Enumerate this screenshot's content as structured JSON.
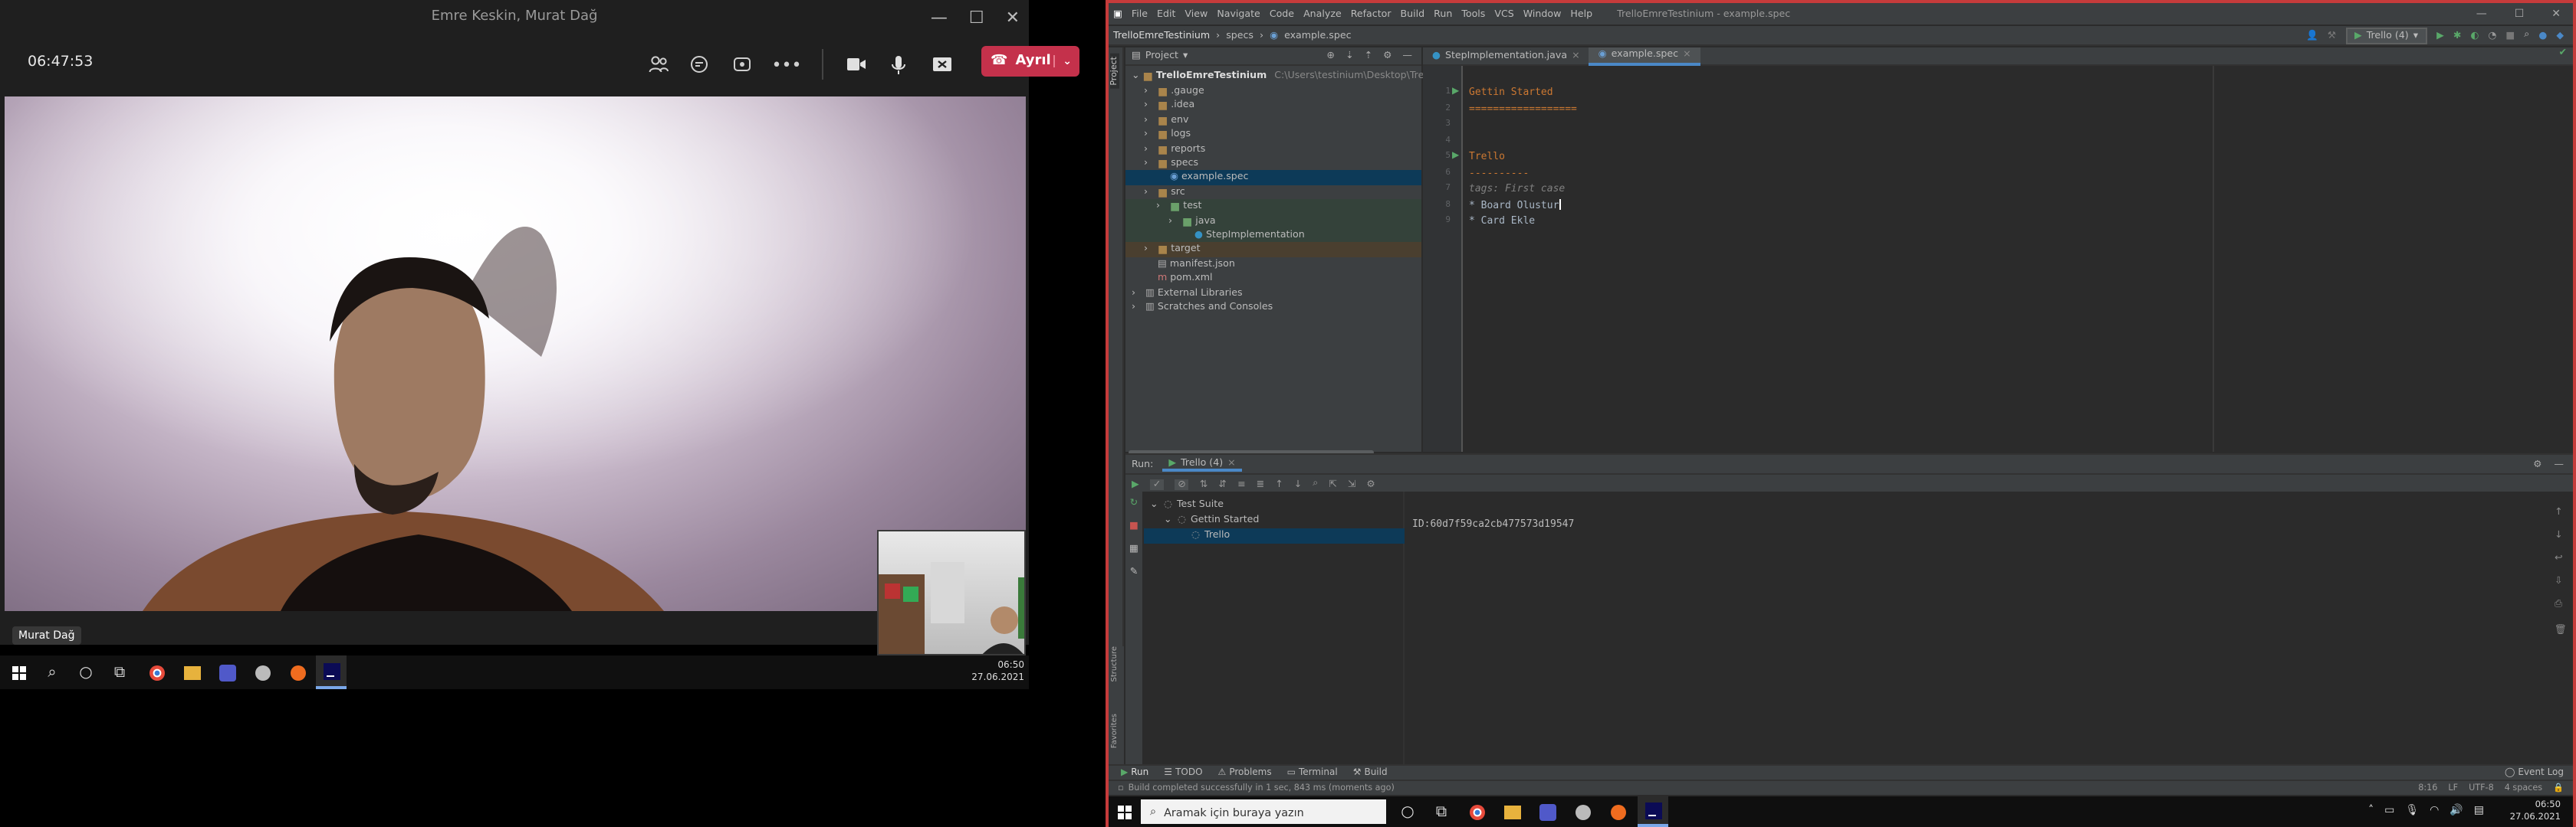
{
  "teams": {
    "title": "Emre Keskin, Murat Dağ",
    "timer": "06:47:53",
    "leave_label": "Ayrıl",
    "participant_name": "Murat Dağ"
  },
  "taskbar1": {
    "time": "06:50",
    "date": "27.06.2021"
  },
  "ide": {
    "menu": [
      "File",
      "Edit",
      "View",
      "Navigate",
      "Code",
      "Analyze",
      "Refactor",
      "Build",
      "Run",
      "Tools",
      "VCS",
      "Window",
      "Help"
    ],
    "window_title": "TrelloEmreTestinium - example.spec",
    "breadcrumb": [
      "TrelloEmreTestinium",
      "specs",
      "example.spec"
    ],
    "run_config": "Trello (4)",
    "project_label": "Project",
    "project_root": "TrelloEmreTestinium",
    "project_path": "C:\\Users\\testinium\\Desktop\\TrelloEmreTe",
    "tree": [
      {
        "label": ".gauge",
        "depth": 1
      },
      {
        "label": ".idea",
        "depth": 1
      },
      {
        "label": "env",
        "depth": 1
      },
      {
        "label": "logs",
        "depth": 1
      },
      {
        "label": "reports",
        "depth": 1
      },
      {
        "label": "specs",
        "depth": 1
      },
      {
        "label": "example.spec",
        "depth": 2
      },
      {
        "label": "src",
        "depth": 1
      },
      {
        "label": "test",
        "depth": 2
      },
      {
        "label": "java",
        "depth": 3
      },
      {
        "label": "StepImplementation",
        "depth": 4
      },
      {
        "label": "target",
        "depth": 1
      },
      {
        "label": "manifest.json",
        "depth": 1
      },
      {
        "label": "pom.xml",
        "depth": 1
      },
      {
        "label": "External Libraries",
        "depth": 0
      },
      {
        "label": "Scratches and Consoles",
        "depth": 0
      }
    ],
    "tabs": [
      "StepImplementation.java",
      "example.spec"
    ],
    "code_lines": [
      {
        "n": "1",
        "text": "Gettin Started",
        "color": "#cc7832"
      },
      {
        "n": "2",
        "text": "==================",
        "color": "#cc7832"
      },
      {
        "n": "3",
        "text": "",
        "color": "#a9b7c6"
      },
      {
        "n": "4",
        "text": "",
        "color": "#a9b7c6"
      },
      {
        "n": "5",
        "text": "Trello",
        "color": "#cc7832"
      },
      {
        "n": "6",
        "text": "----------",
        "color": "#cc7832"
      },
      {
        "n": "7",
        "text": "tags: First case",
        "color": "#808080"
      },
      {
        "n": "8",
        "text": "* Board Olustur",
        "color": "#a9b7c6"
      },
      {
        "n": "9",
        "text": "* Card Ekle",
        "color": "#a9b7c6"
      }
    ],
    "run_label": "Run:",
    "run_tab": "Trello (4)",
    "run_tree": [
      {
        "label": "Test Suite",
        "depth": 0
      },
      {
        "label": "Gettin Started",
        "depth": 1
      },
      {
        "label": "Trello",
        "depth": 2
      }
    ],
    "console_text": "ID:60d7f59ca2cb477573d19547",
    "bottom_tabs": [
      "Run",
      "TODO",
      "Problems",
      "Terminal",
      "Build"
    ],
    "event_log": "Event Log",
    "status_message": "Build completed successfully in 1 sec, 843 ms (moments ago)",
    "status_right": [
      "8:16",
      "LF",
      "UTF-8",
      "4 spaces"
    ]
  },
  "taskbar2": {
    "search_placeholder": "Aramak için buraya yazın",
    "time": "06:50",
    "date": "27.06.2021"
  },
  "colors": {
    "teams_leave": "#c4314b",
    "ide_border": "#c63b3b",
    "keyword_orange": "#cc7832",
    "console_green": "#6a8759"
  }
}
